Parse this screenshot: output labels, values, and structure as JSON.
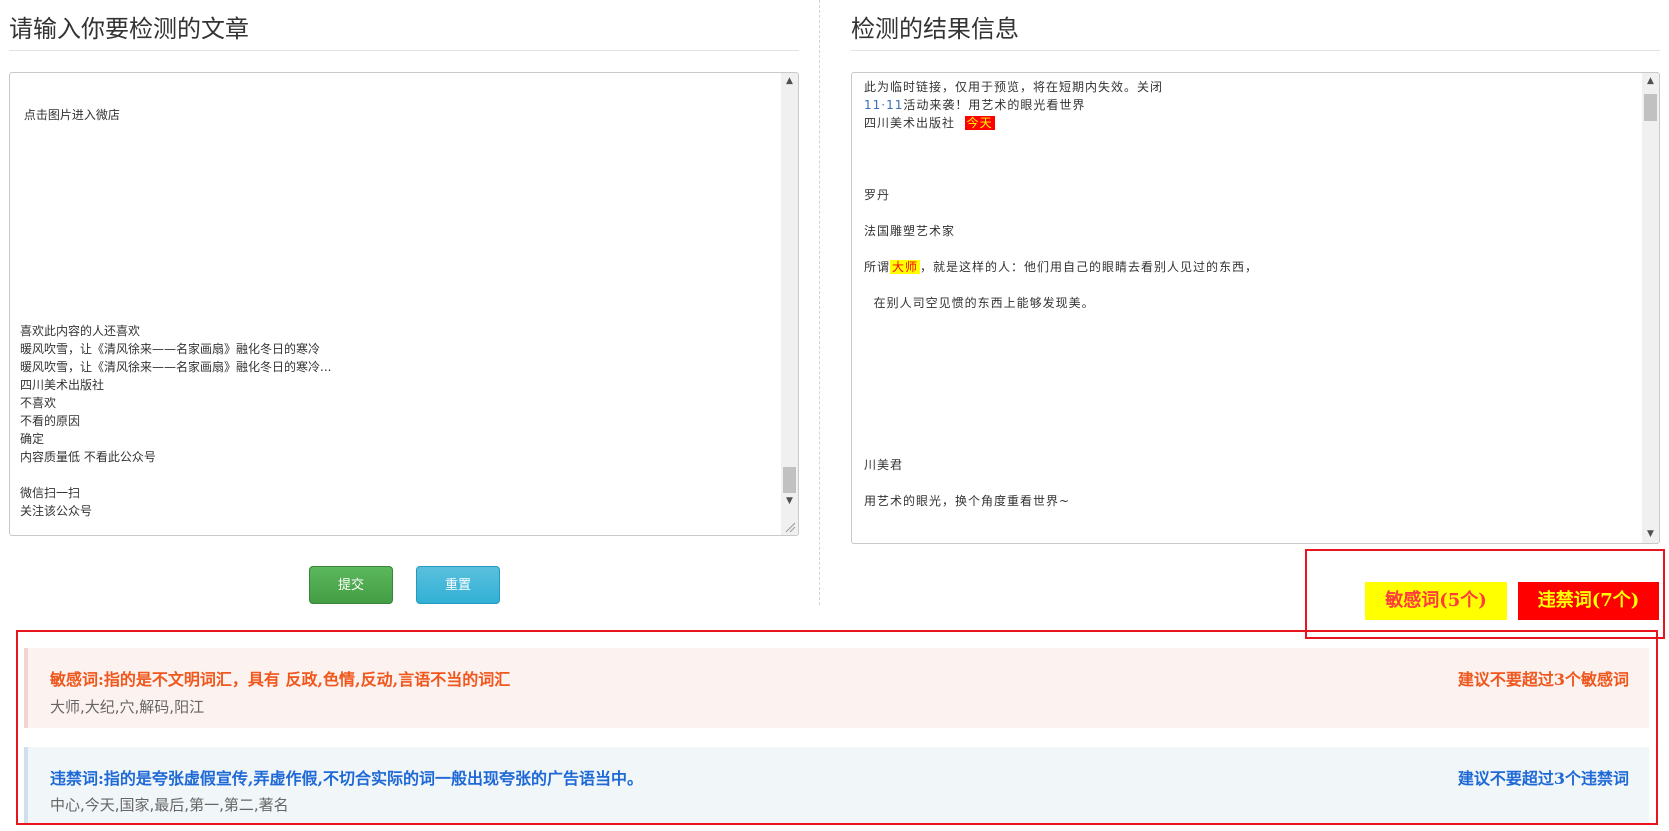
{
  "left_panel": {
    "title": "请输入你要检测的文章",
    "text_lines": [
      "",
      "",
      " 点击图片进入微店",
      "",
      "",
      "",
      "",
      "",
      "",
      "",
      "",
      "",
      "",
      "",
      "喜欢此内容的人还喜欢",
      "暖风吹雪，让《清风徐来——名家画扇》融化冬日的寒冷",
      "暖风吹雪，让《清风徐来——名家画扇》融化冬日的寒冷...",
      "四川美术出版社",
      "不喜欢",
      "不看的原因",
      "确定",
      "内容质量低 不看此公众号",
      "",
      "微信扫一扫",
      "关注该公众号"
    ],
    "submit_label": "提交",
    "reset_label": "重置"
  },
  "right_panel": {
    "title": "检测的结果信息",
    "line1": "此为临时链接，仅用于预览，将在短期内失效。关闭",
    "line2_num": "11·11",
    "line2_text": "活动来袭！用艺术的眼光看世界",
    "line3_text": "四川美术出版社  ",
    "line3_hl": "今天",
    "line4": "罗丹",
    "line5": "法国雕塑艺术家",
    "line6_pre": "所谓",
    "line6_hl": "大师",
    "line6_post": "，就是这样的人：他们用自己的眼睛去看别人见过的东西，",
    "line7": "  在别人司空见惯的东西上能够发现美。",
    "line8": "川美君",
    "line9": "用艺术的眼光，换个角度重看世界~"
  },
  "badges": {
    "sensitive": "敏感词(5个)",
    "forbidden": "违禁词(7个)"
  },
  "sensitive_info": {
    "heading": "敏感词:指的是不文明词汇，具有 反政,色情,反动,言语不当的词汇",
    "advice": "建议不要超过3个敏感词",
    "words": "大师,大纪,穴,解码,阳江"
  },
  "forbidden_info": {
    "heading": "违禁词:指的是夸张虚假宣传,弄虚作假,不切合实际的词一般出现夸张的广告语当中。",
    "advice": "建议不要超过3个违禁词",
    "words": "中心,今天,国家,最后,第一,第二,著名"
  },
  "colors": {
    "highlight_red": "#ff0000",
    "highlight_yellow": "#ffff00",
    "sensitive_text": "#f0571c",
    "forbidden_text": "#1f69d6",
    "frame_red": "#e8141e"
  }
}
